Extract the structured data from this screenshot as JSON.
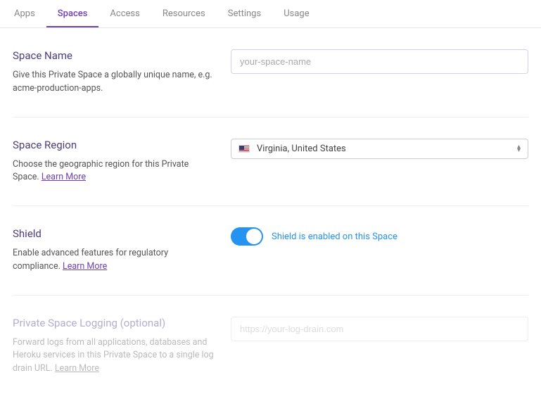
{
  "tabs": {
    "apps": "Apps",
    "spaces": "Spaces",
    "access": "Access",
    "resources": "Resources",
    "settings": "Settings",
    "usage": "Usage"
  },
  "spaceName": {
    "title": "Space Name",
    "desc": "Give this Private Space a globally unique name, e.g. acme-production-apps.",
    "placeholder": "your-space-name"
  },
  "region": {
    "title": "Space Region",
    "desc": "Choose the geographic region for this Private Space. ",
    "learnMore": "Learn More",
    "selected": "Virginia, United States"
  },
  "shield": {
    "title": "Shield",
    "desc": "Enable advanced features for regulatory compliance. ",
    "learnMore": "Learn More",
    "statusText": "Shield is enabled on this Space"
  },
  "logging": {
    "title": "Private Space Logging (optional)",
    "desc": "Forward logs from all applications, databases and Heroku services in this Private Space to a single log drain URL. ",
    "learnMore": "Learn More",
    "placeholder": "https://your-log-drain.com"
  }
}
